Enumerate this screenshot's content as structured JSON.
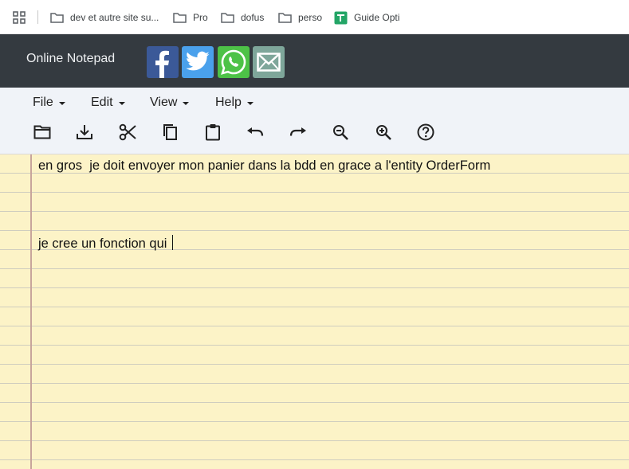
{
  "bookmarks": [
    {
      "label": "dev et autre site su...",
      "icon": "folder-icon"
    },
    {
      "label": "Pro",
      "icon": "folder-icon"
    },
    {
      "label": "dofus",
      "icon": "folder-icon"
    },
    {
      "label": "perso",
      "icon": "folder-icon"
    },
    {
      "label": "Guide Opti",
      "icon": "sheets-icon"
    }
  ],
  "header": {
    "title": "Online Notepad",
    "share": [
      {
        "name": "facebook",
        "color": "#3b5998"
      },
      {
        "name": "twitter",
        "color": "#4aa1ec"
      },
      {
        "name": "whatsapp",
        "color": "#4dc247"
      },
      {
        "name": "email",
        "color": "#7ea69a"
      }
    ]
  },
  "menu": {
    "items": [
      "File",
      "Edit",
      "View",
      "Help"
    ]
  },
  "toolbar": {
    "icons": [
      "open-folder-icon",
      "download-icon",
      "cut-icon",
      "copy-icon",
      "paste-icon",
      "undo-icon",
      "redo-icon",
      "zoom-out-icon",
      "zoom-in-icon",
      "help-icon"
    ]
  },
  "editor": {
    "lines": [
      "en gros  je doit envoyer mon panier dans la bdd en grace a l'entity OrderForm",
      "",
      "",
      "je cree un fonction qui "
    ]
  }
}
